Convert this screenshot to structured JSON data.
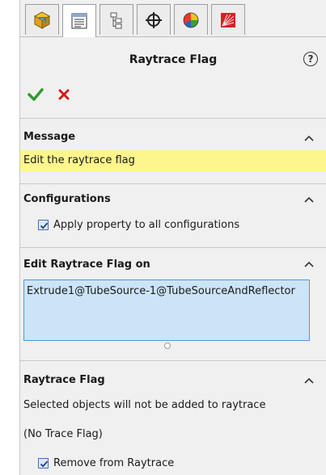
{
  "tabs": [
    {
      "icon": "feature-manager-icon"
    },
    {
      "icon": "property-manager-icon",
      "active": true
    },
    {
      "icon": "configuration-manager-icon"
    },
    {
      "icon": "dimxpert-manager-icon"
    },
    {
      "icon": "display-manager-icon"
    },
    {
      "icon": "tracepro-icon"
    }
  ],
  "title": "Raytrace Flag",
  "help_symbol": "?",
  "sections": {
    "message": {
      "title": "Message",
      "text": "Edit the raytrace flag"
    },
    "configurations": {
      "title": "Configurations",
      "checkbox_label": "Apply property to all configurations",
      "checked": true
    },
    "edit_on": {
      "title": "Edit Raytrace Flag on",
      "items": [
        "Extrude1@TubeSource-1@TubeSourceAndReflector"
      ]
    },
    "raytrace_flag": {
      "title": "Raytrace Flag",
      "description": "Selected objects will not be added to raytrace",
      "status": "(No Trace Flag)",
      "checkbox_label": "Remove from Raytrace",
      "checked": true
    }
  },
  "colors": {
    "message_bg": "#fcf68c",
    "selection_bg": "#cce4f7",
    "ok_green": "#2e9b2e",
    "cancel_red": "#d0201a"
  }
}
